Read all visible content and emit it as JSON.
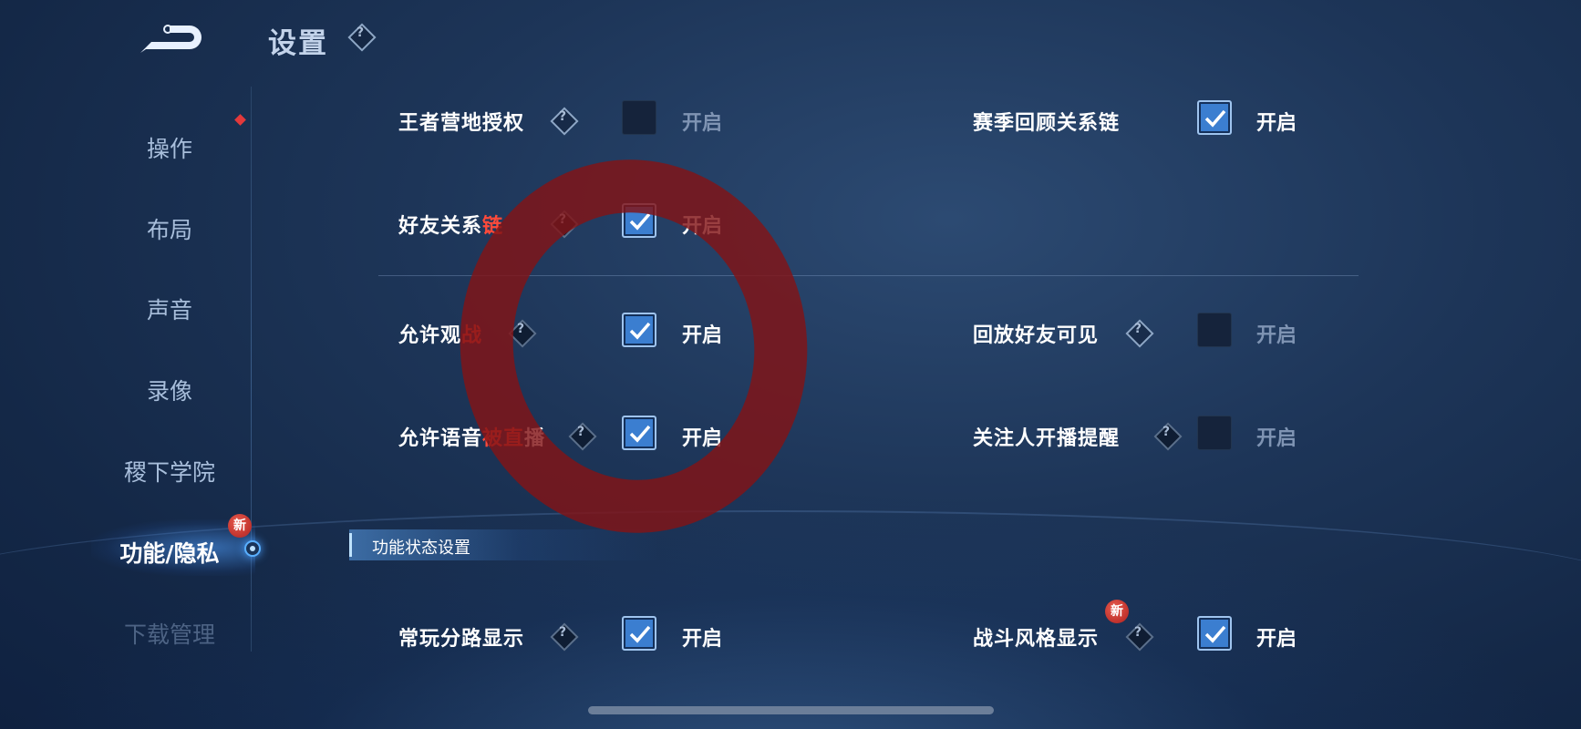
{
  "header": {
    "title": "设置"
  },
  "sidebar": {
    "items": [
      {
        "label": "操作"
      },
      {
        "label": "布局"
      },
      {
        "label": "声音"
      },
      {
        "label": "录像"
      },
      {
        "label": "稷下学院"
      },
      {
        "label": "功能/隐私"
      },
      {
        "label": "下载管理"
      }
    ],
    "active_index": 5,
    "new_badge": "新"
  },
  "settings": {
    "wangzhe_auth": {
      "label": "王者营地授权",
      "state": "开启",
      "checked": false
    },
    "friend_chain": {
      "label_a": "好友关系",
      "label_b": "链",
      "state": "开启",
      "checked": true
    },
    "season_review": {
      "label": "赛季回顾关系链",
      "state": "开启",
      "checked": true
    },
    "allow_watch": {
      "label_a": "允许观",
      "label_b": "战",
      "state": "开启",
      "checked": true
    },
    "replay_visible": {
      "label": "回放好友可见",
      "state": "开启",
      "checked": false
    },
    "voice_broadcast": {
      "label_a": "允许语音",
      "label_b": "被直",
      "label_c": "播",
      "state": "开启",
      "checked": true
    },
    "follow_remind": {
      "label": "关注人开播提醒",
      "state": "开启",
      "checked": false
    },
    "lane_display": {
      "label": "常玩分路显示",
      "state": "开启",
      "checked": true
    },
    "battle_style": {
      "label": "战斗风格显示",
      "state": "开启",
      "checked": true,
      "badge": "新"
    }
  },
  "section": {
    "title": "功能状态设置"
  },
  "icons": {
    "help": "?",
    "back": "back-arrow-icon",
    "check": "checkmark-icon"
  },
  "colors": {
    "accent": "#3b7ed0",
    "highlight": "#ff4a3a",
    "badge": "#c62a24"
  }
}
